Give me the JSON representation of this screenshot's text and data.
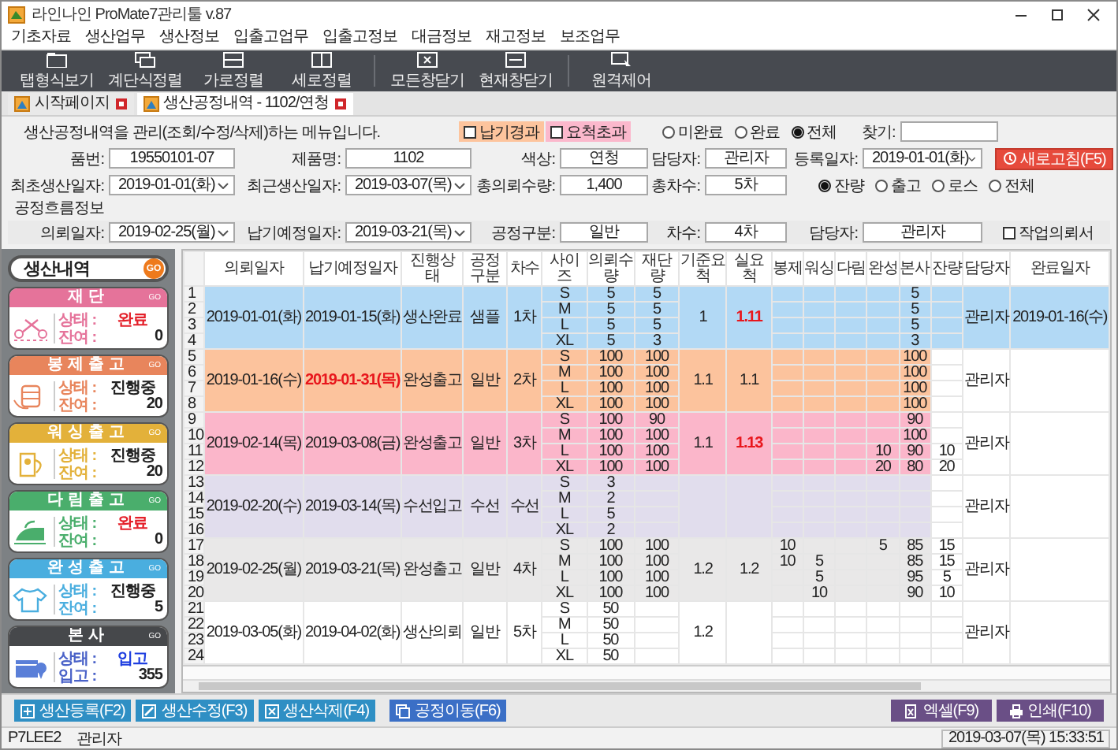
{
  "window": {
    "title": "라인나인 ProMate7관리툴 v.87"
  },
  "menu": [
    "기초자료",
    "생산업무",
    "생산정보",
    "입출고업무",
    "입출고정보",
    "대금정보",
    "재고정보",
    "보조업무"
  ],
  "toolbar": [
    {
      "label": "탭형식보기",
      "kind": "tabs"
    },
    {
      "label": "계단식정렬",
      "kind": "cascade"
    },
    {
      "label": "가로정렬",
      "kind": "rows"
    },
    {
      "label": "세로정렬",
      "kind": "cols"
    },
    {
      "label": "모든창닫기",
      "kind": "closeall"
    },
    {
      "label": "현재창닫기",
      "kind": "close"
    },
    {
      "label": "원격제어",
      "kind": "remote"
    }
  ],
  "tabs": [
    {
      "label": "시작페이지",
      "selected": false
    },
    {
      "label": "생산공정내역 - 1102/연청",
      "selected": true
    }
  ],
  "form": {
    "description": "생산공정내역을 관리(조회/수정/삭제)하는 메뉴입니다.",
    "filters": [
      {
        "label": "납기경과",
        "checked": false,
        "color": "#fdc49d"
      },
      {
        "label": "요척초과",
        "checked": false,
        "color": "#fbb8cc"
      }
    ],
    "completion_radios": [
      {
        "label": "미완료",
        "selected": false
      },
      {
        "label": "완료",
        "selected": false
      },
      {
        "label": "전체",
        "selected": true
      }
    ],
    "search_label": "찾기:",
    "refresh_button": "새로고침(F5)",
    "row1": [
      {
        "label": "품번:",
        "value": "19550101-07",
        "kind": "text"
      },
      {
        "label": "제품명:",
        "value": "1102",
        "kind": "text"
      },
      {
        "label": "색상:",
        "value": "연청",
        "kind": "text"
      },
      {
        "label": "담당자:",
        "value": "관리자",
        "kind": "text"
      },
      {
        "label": "등록일자:",
        "value": "2019-01-01(화)",
        "kind": "select"
      }
    ],
    "row2": [
      {
        "label": "최초생산일자:",
        "value": "2019-01-01(화)",
        "kind": "select"
      },
      {
        "label": "최근생산일자:",
        "value": "2019-03-07(목)",
        "kind": "select"
      },
      {
        "label": "총의뢰수량:",
        "value": "1,400",
        "kind": "text"
      },
      {
        "label": "총차수:",
        "value": "5차",
        "kind": "text"
      }
    ],
    "quantity_radios": [
      {
        "label": "잔량",
        "selected": true
      },
      {
        "label": "출고",
        "selected": false
      },
      {
        "label": "로스",
        "selected": false
      },
      {
        "label": "전체",
        "selected": false
      }
    ],
    "section_title": "공정흐름정보",
    "row3": [
      {
        "label": "의뢰일자:",
        "value": "2019-02-25(월)",
        "kind": "select"
      },
      {
        "label": "납기예정일자:",
        "value": "2019-03-21(목)",
        "kind": "select"
      },
      {
        "label": "공정구분:",
        "value": "일반",
        "kind": "text"
      },
      {
        "label": "차수:",
        "value": "4차",
        "kind": "text"
      },
      {
        "label": "담당자:",
        "value": "관리자",
        "kind": "text"
      }
    ],
    "work_order": {
      "label": "작업의뢰서",
      "checked": false
    }
  },
  "side_panel": {
    "title": "생산내역",
    "go": "GO",
    "stages": [
      {
        "title": "재단",
        "go": "GO",
        "color": "#e5739a",
        "status_label": "상태 :",
        "status": {
          "text": "완료",
          "color": "#e4202a"
        },
        "count_label": "잔여 :",
        "count": "0"
      },
      {
        "title": "봉제출고",
        "go": "GO",
        "color": "#e8855c",
        "status_label": "상태 :",
        "status": {
          "text": "진행중",
          "color": "#222222"
        },
        "count_label": "잔여 :",
        "count": "20"
      },
      {
        "title": "워싱출고",
        "go": "GO",
        "color": "#e3b13a",
        "status_label": "상태 :",
        "status": {
          "text": "진행중",
          "color": "#222222"
        },
        "count_label": "잔여 :",
        "count": "20"
      },
      {
        "title": "다림출고",
        "go": "GO",
        "color": "#4aae6c",
        "status_label": "상태 :",
        "status": {
          "text": "완료",
          "color": "#e4202a"
        },
        "count_label": "잔여 :",
        "count": "0"
      },
      {
        "title": "완성출고",
        "go": "GO",
        "color": "#4aaedf",
        "status_label": "상태 :",
        "status": {
          "text": "진행중",
          "color": "#222222"
        },
        "count_label": "잔여 :",
        "count": "5"
      },
      {
        "title": "본사",
        "go": "GO",
        "color": "#46484b",
        "status_label": "상태 :",
        "status": {
          "text": "입고",
          "color": "#1f3fe0"
        },
        "count_label": "입고 :",
        "count": "355"
      }
    ]
  },
  "table": {
    "columns": [
      "의뢰일자",
      "납기예정일자",
      "진행상태",
      "공정구분",
      "차수",
      "사이즈",
      "의뢰수량",
      "재단량",
      "기준요척",
      "실요척",
      "봉제",
      "워싱",
      "다림",
      "완성",
      "본사",
      "잔량",
      "담당자",
      "완료일자"
    ],
    "groups": [
      {
        "request_date": "2019-01-01(화)",
        "due_date": "2019-01-15(화)",
        "due_overdue": false,
        "status": "생산완료",
        "process_type": "샘플",
        "round": "1차",
        "standard_yield": "1",
        "actual_yield": "1.11",
        "yield_over": true,
        "manager": "관리자",
        "completed_date": "2019-01-16(수)",
        "color": "#b2d9f5",
        "rows": [
          {
            "no": "1",
            "size": "S",
            "qty": "5",
            "cut": "5",
            "hq": "5"
          },
          {
            "no": "2",
            "size": "M",
            "qty": "5",
            "cut": "5",
            "hq": "5"
          },
          {
            "no": "3",
            "size": "L",
            "qty": "5",
            "cut": "5",
            "hq": "5"
          },
          {
            "no": "4",
            "size": "XL",
            "qty": "5",
            "cut": "3",
            "hq": "3"
          }
        ]
      },
      {
        "request_date": "2019-01-16(수)",
        "due_date": "2019-01-31(목)",
        "due_overdue": true,
        "status": "완성출고",
        "process_type": "일반",
        "round": "2차",
        "standard_yield": "1.1",
        "actual_yield": "1.1",
        "yield_over": false,
        "manager": "관리자",
        "color": "#fcc39d",
        "rows": [
          {
            "no": "5",
            "size": "S",
            "qty": "100",
            "cut": "100",
            "hq": "100"
          },
          {
            "no": "6",
            "size": "M",
            "qty": "100",
            "cut": "100",
            "hq": "100"
          },
          {
            "no": "7",
            "size": "L",
            "qty": "100",
            "cut": "100",
            "hq": "100"
          },
          {
            "no": "8",
            "size": "XL",
            "qty": "100",
            "cut": "100",
            "hq": "100"
          }
        ]
      },
      {
        "request_date": "2019-02-14(목)",
        "due_date": "2019-03-08(금)",
        "due_overdue": false,
        "status": "완성출고",
        "process_type": "일반",
        "round": "3차",
        "standard_yield": "1.1",
        "actual_yield": "1.13",
        "yield_over": true,
        "manager": "관리자",
        "color": "#fbb6ca",
        "rows": [
          {
            "no": "9",
            "size": "S",
            "qty": "100",
            "cut": "90",
            "hq": "90"
          },
          {
            "no": "10",
            "size": "M",
            "qty": "100",
            "cut": "100",
            "hq": "100"
          },
          {
            "no": "11",
            "size": "L",
            "qty": "100",
            "cut": "100",
            "finishing": "10",
            "hq": "90",
            "remain": "10"
          },
          {
            "no": "12",
            "size": "XL",
            "qty": "100",
            "cut": "100",
            "finishing": "20",
            "hq": "80",
            "remain": "20"
          }
        ]
      },
      {
        "request_date": "2019-02-20(수)",
        "due_date": "2019-03-14(목)",
        "due_overdue": false,
        "status": "수선입고",
        "process_type": "수선",
        "round": "수선",
        "yield_over": false,
        "manager": "관리자",
        "color": "#e1dded",
        "rows": [
          {
            "no": "13",
            "size": "S",
            "qty": "3"
          },
          {
            "no": "14",
            "size": "M",
            "qty": "2"
          },
          {
            "no": "15",
            "size": "L",
            "qty": "5"
          },
          {
            "no": "16",
            "size": "XL",
            "qty": "2"
          }
        ]
      },
      {
        "request_date": "2019-02-25(월)",
        "due_date": "2019-03-21(목)",
        "due_overdue": false,
        "status": "완성출고",
        "process_type": "일반",
        "round": "4차",
        "standard_yield": "1.2",
        "actual_yield": "1.2",
        "yield_over": false,
        "manager": "관리자",
        "color": "#e9e8e8",
        "rows": [
          {
            "no": "17",
            "size": "S",
            "qty": "100",
            "cut": "100",
            "sewing": "10",
            "finishing": "5",
            "hq": "85",
            "remain": "15"
          },
          {
            "no": "18",
            "size": "M",
            "qty": "100",
            "cut": "100",
            "sewing": "10",
            "washing": "5",
            "hq": "85",
            "remain": "15"
          },
          {
            "no": "19",
            "size": "L",
            "qty": "100",
            "cut": "100",
            "washing": "5",
            "hq": "95",
            "remain": "5"
          },
          {
            "no": "20",
            "size": "XL",
            "qty": "100",
            "cut": "100",
            "washing": "10",
            "hq": "90",
            "remain": "10"
          }
        ]
      },
      {
        "request_date": "2019-03-05(화)",
        "due_date": "2019-04-02(화)",
        "due_overdue": false,
        "status": "생산의뢰",
        "process_type": "일반",
        "round": "5차",
        "standard_yield": "1.2",
        "yield_over": false,
        "manager": "관리자",
        "color": "#ffffff",
        "rows": [
          {
            "no": "21",
            "size": "S",
            "qty": "50"
          },
          {
            "no": "22",
            "size": "M",
            "qty": "50"
          },
          {
            "no": "23",
            "size": "L",
            "qty": "50"
          },
          {
            "no": "24",
            "size": "XL",
            "qty": "50"
          }
        ]
      }
    ]
  },
  "actions": [
    {
      "label": "생산등록(F2)",
      "kind": "add"
    },
    {
      "label": "생산수정(F3)",
      "kind": "edit"
    },
    {
      "label": "생산삭제(F4)",
      "kind": "delete"
    },
    {
      "label": "공정이동(F6)",
      "kind": "move"
    }
  ],
  "output_actions": [
    {
      "label": "엑셀(F9)",
      "kind": "excel"
    },
    {
      "label": "인쇄(F10)",
      "kind": "print"
    }
  ],
  "status_bar": {
    "terminal": "P7LEE2",
    "user": "관리자",
    "datetime": "2019-03-07(목) 15:33:51"
  }
}
